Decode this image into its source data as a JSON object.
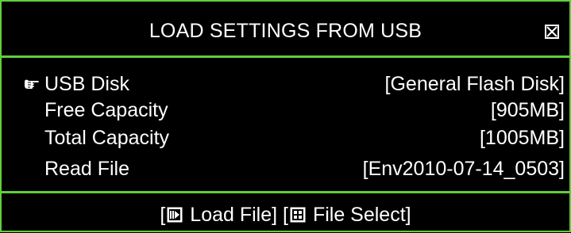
{
  "dialog": {
    "title": "LOAD SETTINGS FROM USB",
    "close_icon": "close-box-icon",
    "accent_color": "#5fcf3c"
  },
  "rows": [
    {
      "label": "USB Disk",
      "value": "[General Flash Disk]",
      "selected": true,
      "icon": "pointing-hand-icon"
    },
    {
      "label": "Free Capacity",
      "value": "[905MB]"
    },
    {
      "label": "Total Capacity",
      "value": "[1005MB]"
    },
    {
      "label": "Read File",
      "value": "[Env2010-07-14_0503]"
    }
  ],
  "footer": {
    "load_open": "[",
    "load_icon": "play-button-icon",
    "load_label": " Load File]",
    "select_open": "[",
    "select_icon": "grid-button-icon",
    "select_label": " File Select]"
  }
}
